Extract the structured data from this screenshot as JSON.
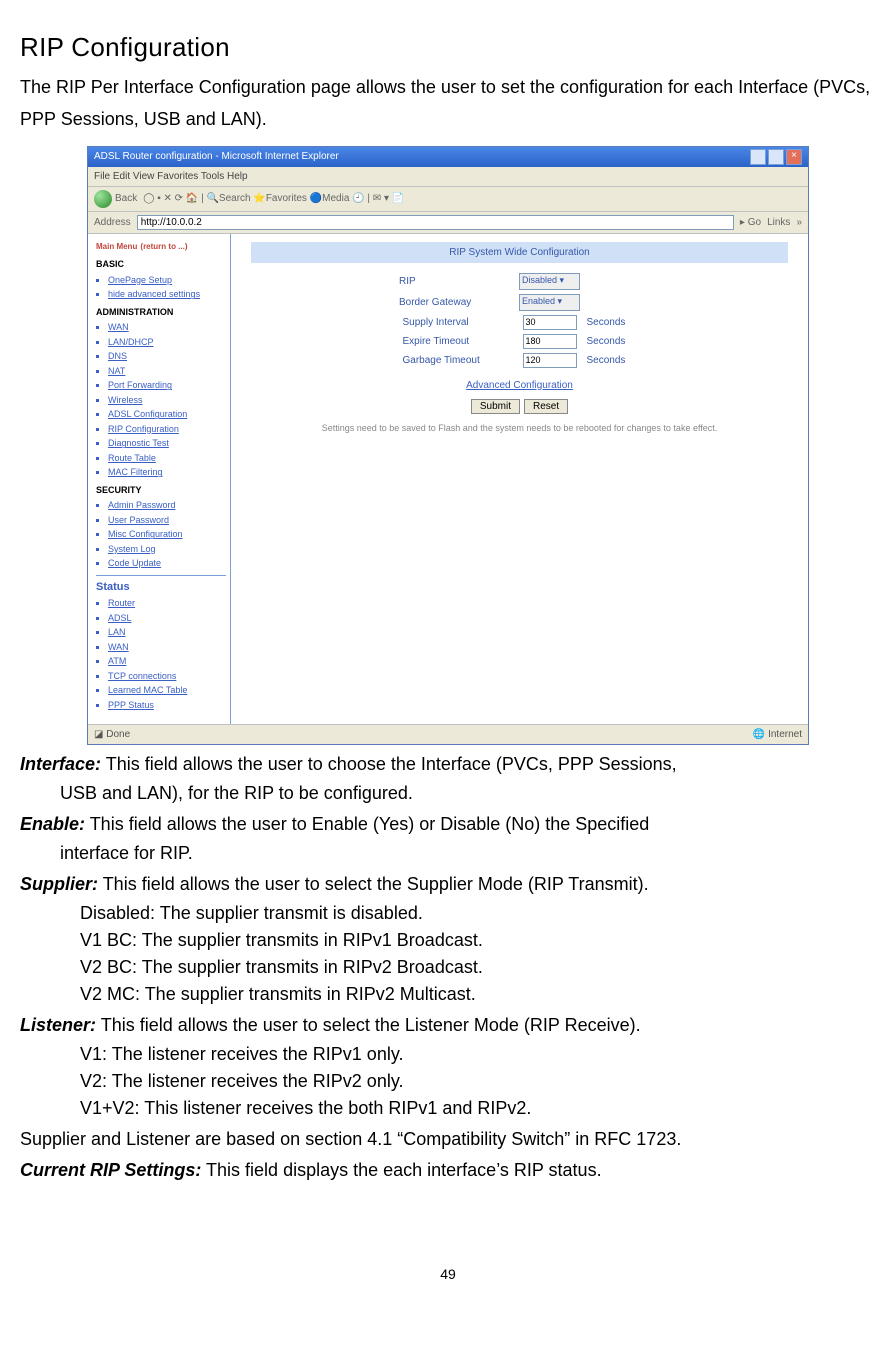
{
  "title": "RIP Configuration",
  "intro": "The RIP Per Interface Configuration page allows the user to set the configuration for each Interface (PVCs, PPP Sessions, USB and LAN).",
  "screenshot": {
    "window_title": "ADSL Router configuration - Microsoft Internet Explorer",
    "menu": "File   Edit   View   Favorites   Tools   Help",
    "back_label": "Back",
    "address_label": "Address",
    "address_value": "http://10.0.0.2",
    "go_label": "Go",
    "links_label": "Links",
    "main_menu_title": "Main Menu",
    "main_menu_note": "(return to ...)",
    "sidebar": {
      "basic": "BASIC",
      "basic_items": [
        "OnePage Setup",
        "hide advanced settings"
      ],
      "admin": "ADMINISTRATION",
      "admin_items": [
        "WAN",
        "LAN/DHCP",
        "DNS",
        "NAT",
        "Port Forwarding",
        "Wireless",
        "ADSL Configuration",
        "RIP Configuration",
        "Diagnostic Test",
        "Route Table",
        "MAC Filtering"
      ],
      "security": "SECURITY",
      "security_items": [
        "Admin Password",
        "User Password",
        "Misc Configuration",
        "System Log",
        "Code Update"
      ],
      "status": "Status",
      "status_items": [
        "Router",
        "ADSL",
        "LAN",
        "WAN",
        "ATM",
        "TCP connections",
        "Learned MAC Table",
        "PPP Status"
      ]
    },
    "panel_title": "RIP System Wide Configuration",
    "rows": {
      "rip_label": "RIP",
      "rip_value": "Disabled",
      "bg_label": "Border Gateway",
      "bg_value": "Enabled",
      "si_label": "Supply Interval",
      "si_value": "30",
      "si_unit": "Seconds",
      "et_label": "Expire Timeout",
      "et_value": "180",
      "et_unit": "Seconds",
      "gt_label": "Garbage Timeout",
      "gt_value": "120",
      "gt_unit": "Seconds"
    },
    "adv_link": "Advanced Configuration",
    "submit": "Submit",
    "reset": "Reset",
    "note": "Settings need to be saved to Flash and the system needs to be rebooted for changes to take effect.",
    "status_done": "Done",
    "status_zone": "Internet"
  },
  "defs": {
    "interface_term": "Interface:",
    "interface_line1": " This field allows the user to choose the Interface (PVCs, PPP Sessions,",
    "interface_line2": "USB and LAN), for the RIP to be configured.",
    "enable_term": "Enable:",
    "enable_line1": " This field allows the user to Enable (Yes) or Disable (No) the Specified",
    "enable_line2": "interface for RIP.",
    "supplier_term": "Supplier:",
    "supplier_line1": " This field allows the user to select the Supplier Mode (RIP Transmit).",
    "supplier_d": "Disabled: The supplier transmit is disabled.",
    "supplier_v1": "V1 BC: The supplier transmits in RIPv1 Broadcast.",
    "supplier_v2b": "V2 BC: The supplier transmits in RIPv2 Broadcast.",
    "supplier_v2m": "V2 MC: The supplier transmits in RIPv2 Multicast.",
    "listener_term": "Listener:",
    "listener_line1": " This field allows the user to select the Listener Mode (RIP Receive).",
    "listener_v1": "V1: The listener receives the RIPv1 only.",
    "listener_v2": "V2: The listener receives the RIPv2 only.",
    "listener_v1v2": "V1+V2: This listener receives the both RIPv1 and RIPv2.",
    "rfc_line": "Supplier and Listener are based on section 4.1 “Compatibility Switch” in RFC 1723.",
    "current_term": "Current RIP Settings:",
    "current_text": " This field displays the each interface’s RIP status."
  },
  "page_number": "49"
}
